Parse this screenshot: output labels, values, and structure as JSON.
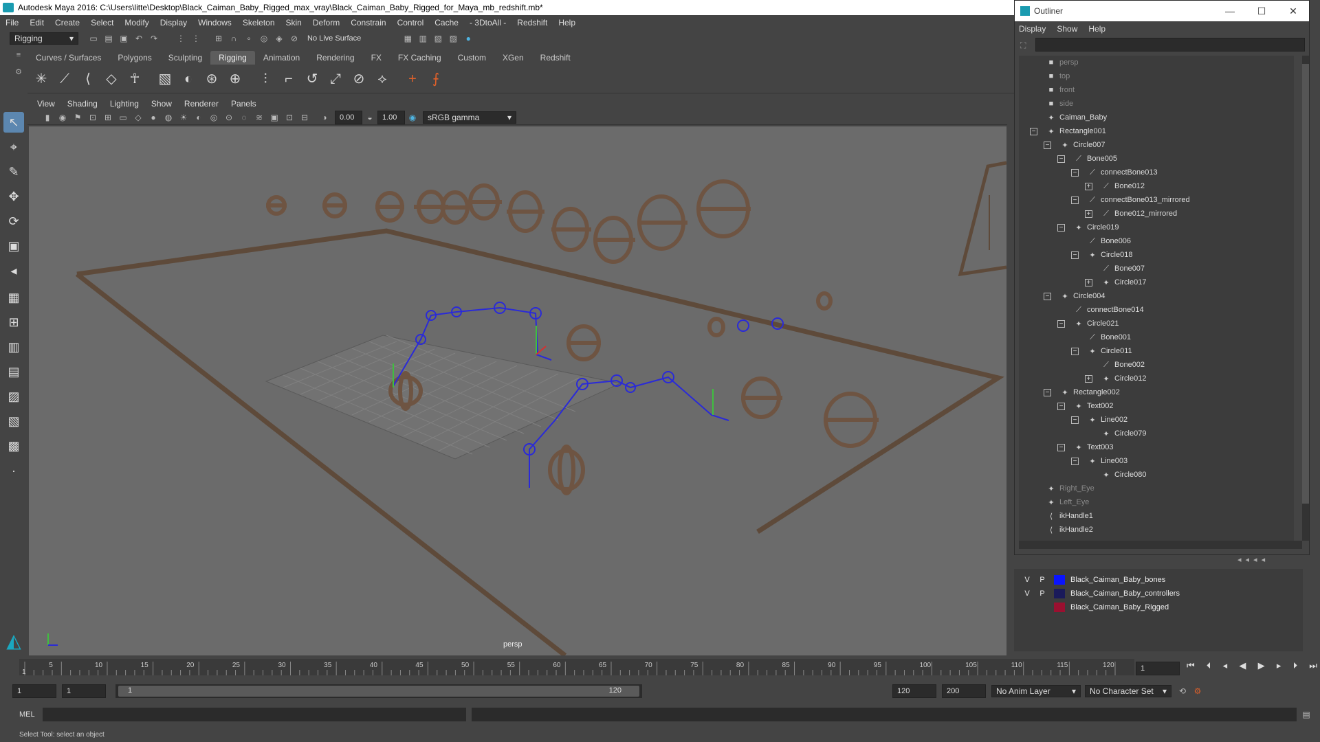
{
  "window": {
    "title": "Autodesk Maya 2016: C:\\Users\\litte\\Desktop\\Black_Caiman_Baby_Rigged_max_vray\\Black_Caiman_Baby_Rigged_for_Maya_mb_redshift.mb*"
  },
  "menubar": [
    "File",
    "Edit",
    "Create",
    "Select",
    "Modify",
    "Display",
    "Windows",
    "Skeleton",
    "Skin",
    "Deform",
    "Constrain",
    "Control",
    "Cache",
    "- 3DtoAll -",
    "Redshift",
    "Help"
  ],
  "statusline": {
    "mode": "Rigging",
    "live_surface": "No Live Surface"
  },
  "shelf_tabs": [
    "Curves / Surfaces",
    "Polygons",
    "Sculpting",
    "Rigging",
    "Animation",
    "Rendering",
    "FX",
    "FX Caching",
    "Custom",
    "XGen",
    "Redshift"
  ],
  "active_shelf_tab": "Rigging",
  "viewport": {
    "menu": [
      "View",
      "Shading",
      "Lighting",
      "Show",
      "Renderer",
      "Panels"
    ],
    "exposure": "0.00",
    "gamma": "1.00",
    "color_space": "sRGB gamma",
    "camera_label": "persp"
  },
  "outliner": {
    "title": "Outliner",
    "menu": [
      "Display",
      "Show",
      "Help"
    ],
    "items": [
      {
        "label": "persp",
        "depth": 0,
        "icon": "camera-icon",
        "dim": true,
        "exp": ""
      },
      {
        "label": "top",
        "depth": 0,
        "icon": "camera-icon",
        "dim": true,
        "exp": ""
      },
      {
        "label": "front",
        "depth": 0,
        "icon": "camera-icon",
        "dim": true,
        "exp": ""
      },
      {
        "label": "side",
        "depth": 0,
        "icon": "camera-icon",
        "dim": true,
        "exp": ""
      },
      {
        "label": "Caiman_Baby",
        "depth": 0,
        "icon": "transform-icon",
        "dim": false,
        "exp": ""
      },
      {
        "label": "Rectangle001",
        "depth": 0,
        "icon": "transform-icon",
        "dim": false,
        "exp": "-"
      },
      {
        "label": "Circle007",
        "depth": 1,
        "icon": "transform-icon",
        "dim": false,
        "exp": "-"
      },
      {
        "label": "Bone005",
        "depth": 2,
        "icon": "joint-icon",
        "dim": false,
        "exp": "-"
      },
      {
        "label": "connectBone013",
        "depth": 3,
        "icon": "joint-icon",
        "dim": false,
        "exp": "-"
      },
      {
        "label": "Bone012",
        "depth": 4,
        "icon": "joint-icon",
        "dim": false,
        "exp": "+"
      },
      {
        "label": "connectBone013_mirrored",
        "depth": 3,
        "icon": "joint-icon",
        "dim": false,
        "exp": "-"
      },
      {
        "label": "Bone012_mirrored",
        "depth": 4,
        "icon": "joint-icon",
        "dim": false,
        "exp": "+"
      },
      {
        "label": "Circle019",
        "depth": 2,
        "icon": "transform-icon",
        "dim": false,
        "exp": "-"
      },
      {
        "label": "Bone006",
        "depth": 3,
        "icon": "joint-icon",
        "dim": false,
        "exp": ""
      },
      {
        "label": "Circle018",
        "depth": 3,
        "icon": "transform-icon",
        "dim": false,
        "exp": "-"
      },
      {
        "label": "Bone007",
        "depth": 4,
        "icon": "joint-icon",
        "dim": false,
        "exp": ""
      },
      {
        "label": "Circle017",
        "depth": 4,
        "icon": "transform-icon",
        "dim": false,
        "exp": "+"
      },
      {
        "label": "Circle004",
        "depth": 1,
        "icon": "transform-icon",
        "dim": false,
        "exp": "-"
      },
      {
        "label": "connectBone014",
        "depth": 2,
        "icon": "joint-icon",
        "dim": false,
        "exp": ""
      },
      {
        "label": "Circle021",
        "depth": 2,
        "icon": "transform-icon",
        "dim": false,
        "exp": "-"
      },
      {
        "label": "Bone001",
        "depth": 3,
        "icon": "joint-icon",
        "dim": false,
        "exp": ""
      },
      {
        "label": "Circle011",
        "depth": 3,
        "icon": "transform-icon",
        "dim": false,
        "exp": "-"
      },
      {
        "label": "Bone002",
        "depth": 4,
        "icon": "joint-icon",
        "dim": false,
        "exp": ""
      },
      {
        "label": "Circle012",
        "depth": 4,
        "icon": "transform-icon",
        "dim": false,
        "exp": "+"
      },
      {
        "label": "Rectangle002",
        "depth": 1,
        "icon": "transform-icon",
        "dim": false,
        "exp": "-"
      },
      {
        "label": "Text002",
        "depth": 2,
        "icon": "transform-icon",
        "dim": false,
        "exp": "-"
      },
      {
        "label": "Line002",
        "depth": 3,
        "icon": "transform-icon",
        "dim": false,
        "exp": "-"
      },
      {
        "label": "Circle079",
        "depth": 4,
        "icon": "transform-icon",
        "dim": false,
        "exp": ""
      },
      {
        "label": "Text003",
        "depth": 2,
        "icon": "transform-icon",
        "dim": false,
        "exp": "-"
      },
      {
        "label": "Line003",
        "depth": 3,
        "icon": "transform-icon",
        "dim": false,
        "exp": "-"
      },
      {
        "label": "Circle080",
        "depth": 4,
        "icon": "transform-icon",
        "dim": false,
        "exp": ""
      },
      {
        "label": "Right_Eye",
        "depth": 0,
        "icon": "transform-icon",
        "dim": true,
        "exp": ""
      },
      {
        "label": "Left_Eye",
        "depth": 0,
        "icon": "transform-icon",
        "dim": true,
        "exp": ""
      },
      {
        "label": "ikHandle1",
        "depth": 0,
        "icon": "ik-handle-icon",
        "dim": false,
        "exp": ""
      },
      {
        "label": "ikHandle2",
        "depth": 0,
        "icon": "ik-handle-icon",
        "dim": false,
        "exp": ""
      }
    ]
  },
  "layers": [
    {
      "v": "V",
      "p": "P",
      "color": "#0a14ff",
      "name": "Black_Caiman_Baby_bones"
    },
    {
      "v": "V",
      "p": "P",
      "color": "#1a1a5a",
      "name": "Black_Caiman_Baby_controllers"
    },
    {
      "v": "",
      "p": "",
      "color": "#9a1030",
      "name": "Black_Caiman_Baby_Rigged"
    }
  ],
  "timeline": {
    "ticks": [
      "1",
      "5",
      "10",
      "15",
      "20",
      "25",
      "30",
      "35",
      "40",
      "45",
      "50",
      "55",
      "60",
      "65",
      "70",
      "75",
      "80",
      "85",
      "90",
      "95",
      "100",
      "105",
      "110",
      "115",
      "120"
    ],
    "current_frame": "1"
  },
  "range": {
    "start": "1",
    "playback_start": "1",
    "slider_start": "1",
    "slider_end": "120",
    "playback_end": "120",
    "end": "200",
    "anim_layer": "No Anim Layer",
    "character_set": "No Character Set"
  },
  "command_line": {
    "label": "MEL"
  },
  "help_line": "Select Tool: select an object"
}
